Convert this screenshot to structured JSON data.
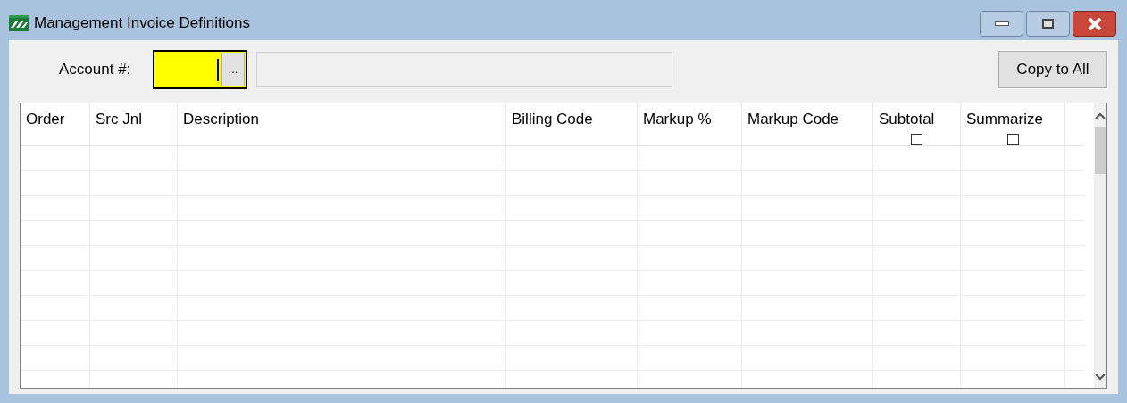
{
  "window": {
    "title": "Management Invoice Definitions"
  },
  "account": {
    "label": "Account #:",
    "browse_button": "..."
  },
  "copy_button": "Copy to All",
  "table": {
    "columns": [
      {
        "label": "Order"
      },
      {
        "label": "Src Jnl"
      },
      {
        "label": "Description"
      },
      {
        "label": "Billing Code"
      },
      {
        "label": "Markup %"
      },
      {
        "label": "Markup Code"
      },
      {
        "label": "Subtotal",
        "header_checkbox": {
          "checked": false
        }
      },
      {
        "label": "Summarize",
        "header_checkbox": {
          "checked": false
        }
      }
    ]
  }
}
